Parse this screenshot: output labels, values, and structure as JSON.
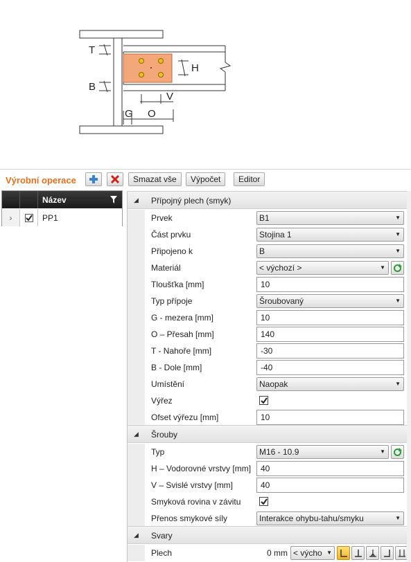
{
  "diagram": {
    "labels": {
      "t": "T",
      "b": "B",
      "h": "H",
      "v": "V",
      "g": "G",
      "o": "O"
    }
  },
  "toolbar": {
    "title": "Výrobní operace",
    "delete_all": "Smazat vše",
    "calculate": "Výpočet",
    "editor": "Editor"
  },
  "grid": {
    "header_name": "Název",
    "row_name": "PP1"
  },
  "sections": {
    "plate": "Přípojný plech (smyk)",
    "bolts": "Šrouby",
    "welds": "Svary"
  },
  "props": [
    {
      "name": "Prvek",
      "value": "B1",
      "type": "combo"
    },
    {
      "name": "Část prvku",
      "value": "Stojina 1",
      "type": "combo"
    },
    {
      "name": "Připojeno k",
      "value": "B",
      "type": "combo"
    },
    {
      "name": "Materiál",
      "value": "< výchozí >",
      "type": "combo-refresh"
    },
    {
      "name": "Tloušťka [mm]",
      "value": "10",
      "type": "text"
    },
    {
      "name": "Typ přípoje",
      "value": "Šroubovaný",
      "type": "combo"
    },
    {
      "name": "G - mezera [mm]",
      "value": "10",
      "type": "text"
    },
    {
      "name": "O – Přesah [mm]",
      "value": "140",
      "type": "text"
    },
    {
      "name": "T - Nahoře [mm]",
      "value": "-30",
      "type": "text"
    },
    {
      "name": "B - Dole [mm]",
      "value": "-40",
      "type": "text"
    },
    {
      "name": "Umístění",
      "value": "Naopak",
      "type": "combo"
    },
    {
      "name": "Výřez",
      "value": "",
      "type": "check"
    },
    {
      "name": "Ofset výřezu [mm]",
      "value": "10",
      "type": "text"
    }
  ],
  "bolt_props": [
    {
      "name": "Typ",
      "value": "M16 - 10.9",
      "type": "combo-refresh"
    },
    {
      "name": "H – Vodorovné vrstvy [mm]",
      "value": "40",
      "type": "text"
    },
    {
      "name": "V – Svislé vrstvy [mm]",
      "value": "40",
      "type": "text"
    },
    {
      "name": "Smyková rovina v závitu",
      "value": "",
      "type": "check"
    },
    {
      "name": "Přenos smykové síly",
      "value": "Interakce ohybu-tahu/smyku",
      "type": "combo"
    }
  ],
  "weld": {
    "name": "Plech",
    "size": "0 mm",
    "type": "< výcho"
  },
  "colors": {
    "accent": "#e0701e",
    "plate": "#f4a87a",
    "bolt": "#f0c020"
  }
}
